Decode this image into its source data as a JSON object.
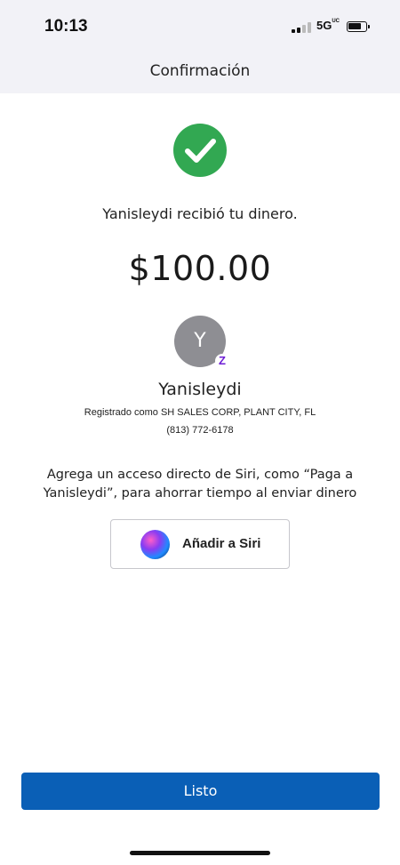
{
  "status_bar": {
    "time": "10:13",
    "network": "5G",
    "network_superscript": "UC"
  },
  "nav": {
    "title": "Confirmación"
  },
  "confirmation": {
    "message": "Yanisleydi recibió tu dinero.",
    "amount": "$100.00",
    "success_color": "#32a852"
  },
  "recipient": {
    "initial": "Y",
    "name": "Yanisleydi",
    "registered": "Registrado como SH SALES CORP, PLANT CITY, FL",
    "phone": "(813) 772-6178",
    "badge_letter": "Z",
    "badge_color": "#6d1ed4"
  },
  "siri": {
    "prompt": "Agrega un acceso directo de Siri, como “Paga a Yanisleydi”, para ahorrar tiempo al enviar dinero",
    "button_label": "Añadir a Siri"
  },
  "actions": {
    "done_label": "Listo",
    "done_color": "#0a5fb6"
  }
}
